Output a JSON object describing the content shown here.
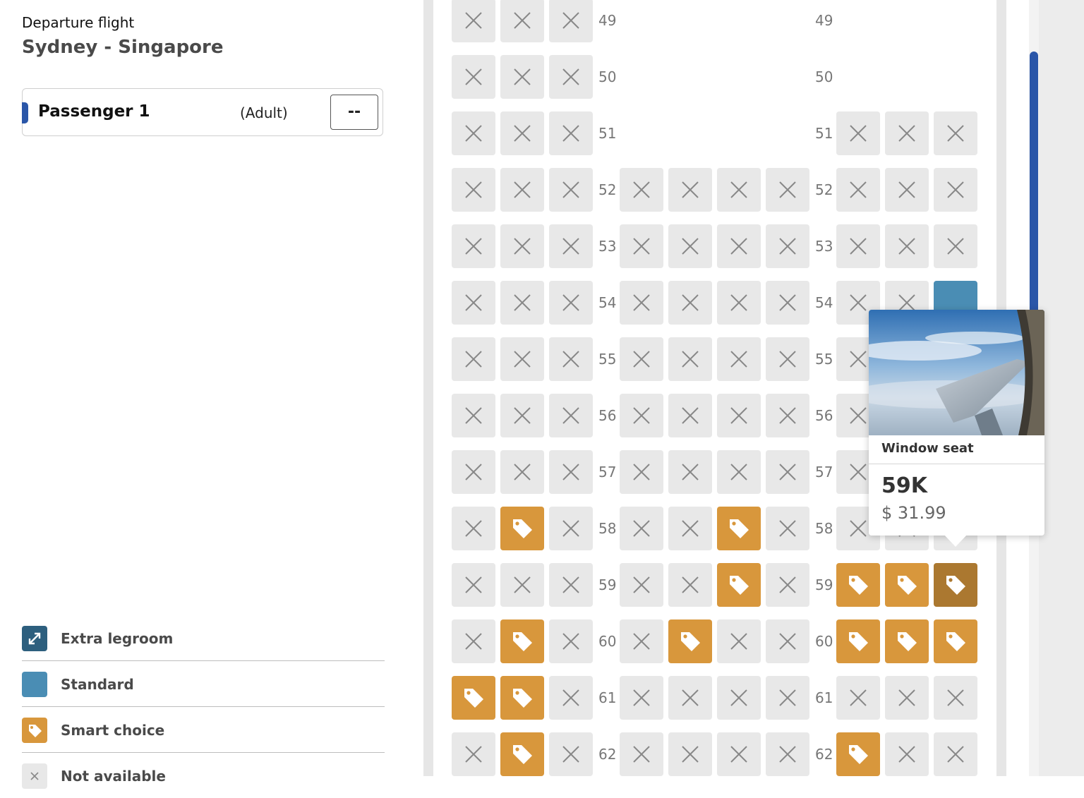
{
  "flight": {
    "label": "Departure flight",
    "route": "Sydney - Singapore"
  },
  "passenger": {
    "name": "Passenger 1",
    "type": "(Adult)",
    "seat": "--"
  },
  "legend": [
    {
      "label": "Extra legroom",
      "color": "#2d5f7e",
      "icon": "expand-arrows-icon"
    },
    {
      "label": "Standard",
      "color": "#4a8db4",
      "icon": "none"
    },
    {
      "label": "Smart choice",
      "color": "#d8973c",
      "icon": "price-tag-icon"
    },
    {
      "label": "Not available",
      "color": "#e8e8e8",
      "icon": "cross-icon"
    }
  ],
  "colors": {
    "accent": "#2a56a8",
    "smart": "#d8973c",
    "smart_selected": "#ab7830",
    "standard": "#4a8db4",
    "unavailable": "#e8e8e8"
  },
  "seatmap": {
    "rows": [
      {
        "num": "49",
        "left": [
          "na",
          "na",
          "na"
        ],
        "middle": [],
        "right": []
      },
      {
        "num": "50",
        "left": [
          "na",
          "na",
          "na"
        ],
        "middle": [],
        "right": []
      },
      {
        "num": "51",
        "left": [
          "na",
          "na",
          "na"
        ],
        "middle": [],
        "right": [
          "na",
          "na",
          "na"
        ]
      },
      {
        "num": "52",
        "left": [
          "na",
          "na",
          "na"
        ],
        "middle": [
          "na",
          "na",
          "na",
          "na"
        ],
        "right": [
          "na",
          "na",
          "na"
        ]
      },
      {
        "num": "53",
        "left": [
          "na",
          "na",
          "na"
        ],
        "middle": [
          "na",
          "na",
          "na",
          "na"
        ],
        "right": [
          "na",
          "na",
          "na"
        ]
      },
      {
        "num": "54",
        "left": [
          "na",
          "na",
          "na"
        ],
        "middle": [
          "na",
          "na",
          "na",
          "na"
        ],
        "right": [
          "na",
          "na",
          "standard"
        ]
      },
      {
        "num": "55",
        "left": [
          "na",
          "na",
          "na"
        ],
        "middle": [
          "na",
          "na",
          "na",
          "na"
        ],
        "right": [
          "na",
          "na",
          "na"
        ]
      },
      {
        "num": "56",
        "left": [
          "na",
          "na",
          "na"
        ],
        "middle": [
          "na",
          "na",
          "na",
          "na"
        ],
        "right": [
          "na",
          "na",
          "na"
        ]
      },
      {
        "num": "57",
        "left": [
          "na",
          "na",
          "na"
        ],
        "middle": [
          "na",
          "na",
          "na",
          "na"
        ],
        "right": [
          "na",
          "na",
          "na"
        ]
      },
      {
        "num": "58",
        "left": [
          "na",
          "smart",
          "na"
        ],
        "middle": [
          "na",
          "na",
          "smart",
          "na"
        ],
        "right": [
          "na",
          "na",
          "na"
        ]
      },
      {
        "num": "59",
        "left": [
          "na",
          "na",
          "na"
        ],
        "middle": [
          "na",
          "na",
          "smart",
          "na"
        ],
        "right": [
          "smart",
          "smart",
          "smart-sel"
        ]
      },
      {
        "num": "60",
        "left": [
          "na",
          "smart",
          "na"
        ],
        "middle": [
          "na",
          "smart",
          "na",
          "na"
        ],
        "right": [
          "smart",
          "smart",
          "smart"
        ]
      },
      {
        "num": "61",
        "left": [
          "smart",
          "smart",
          "na"
        ],
        "middle": [
          "na",
          "na",
          "na",
          "na"
        ],
        "right": [
          "na",
          "na",
          "na"
        ]
      },
      {
        "num": "62",
        "left": [
          "na",
          "smart",
          "na"
        ],
        "middle": [
          "na",
          "na",
          "na",
          "na"
        ],
        "right": [
          "smart",
          "na",
          "na"
        ]
      }
    ]
  },
  "tooltip": {
    "title": "Window seat",
    "seat": "59K",
    "price": "$ 31.99"
  }
}
